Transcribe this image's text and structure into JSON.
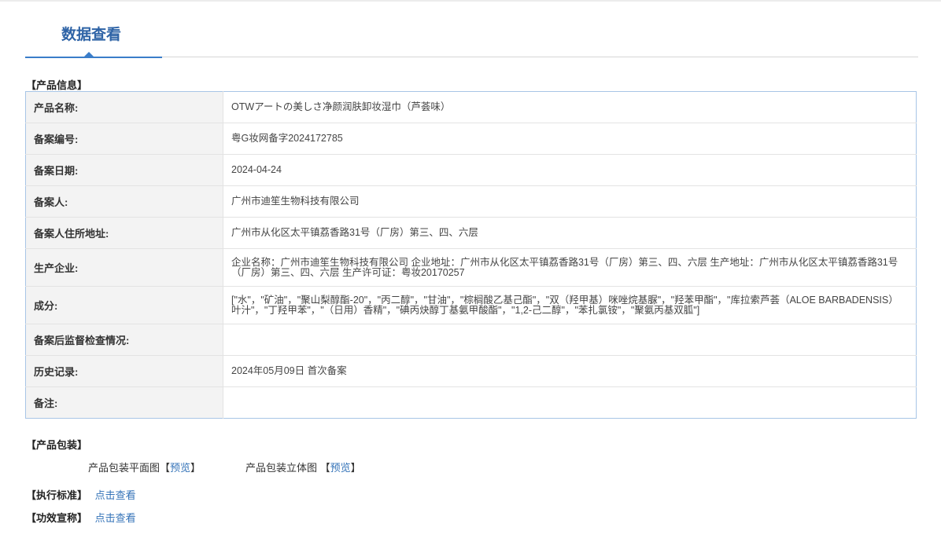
{
  "tab": {
    "title": "数据查看"
  },
  "product_info": {
    "section_title": "【产品信息】",
    "rows": [
      {
        "label": "产品名称:",
        "value": "OTWアートの美しさ净颜润肤卸妆湿巾（芦荟味）"
      },
      {
        "label": "备案编号:",
        "value": "粤G妆网备字2024172785"
      },
      {
        "label": "备案日期:",
        "value": "2024-04-24"
      },
      {
        "label": "备案人:",
        "value": "广州市迪笙生物科技有限公司"
      },
      {
        "label": "备案人住所地址:",
        "value": "广州市从化区太平镇荔香路31号（厂房）第三、四、六层"
      },
      {
        "label": "生产企业:",
        "value": "企业名称：广州市迪笙生物科技有限公司 企业地址：广州市从化区太平镇荔香路31号（厂房）第三、四、六层 生产地址：广州市从化区太平镇荔香路31号（厂房）第三、四、六层 生产许可证：粤妆20170257"
      },
      {
        "label": "成分:",
        "value": "[\"水\"，\"矿油\"，\"聚山梨醇酯-20\"，\"丙二醇\"，\"甘油\"，\"棕榈酸乙基己酯\"，\"双（羟甲基）咪唑烷基脲\"，\"羟苯甲酯\"，\"库拉索芦荟（ALOE BARBADENSIS）叶汁\"，\"丁羟甲苯\"，\"（日用）香精\"，\"碘丙炔醇丁基氨甲酸酯\"，\"1,2-己二醇\"，\"苯扎氯铵\"，\"聚氨丙基双胍\"]"
      },
      {
        "label": "备案后监督检查情况:",
        "value": ""
      },
      {
        "label": "历史记录:",
        "value": "2024年05月09日 首次备案"
      },
      {
        "label": "备注:",
        "value": ""
      }
    ]
  },
  "packaging": {
    "section_title": "【产品包装】",
    "flat_label": "产品包装平面图",
    "threed_label": "产品包装立体图",
    "preview_open": "【",
    "preview_text": "预览",
    "preview_close": "】"
  },
  "standard": {
    "label": "【执行标准】",
    "link": "点击查看"
  },
  "efficacy": {
    "label": "【功效宣称】",
    "link": "点击查看"
  }
}
